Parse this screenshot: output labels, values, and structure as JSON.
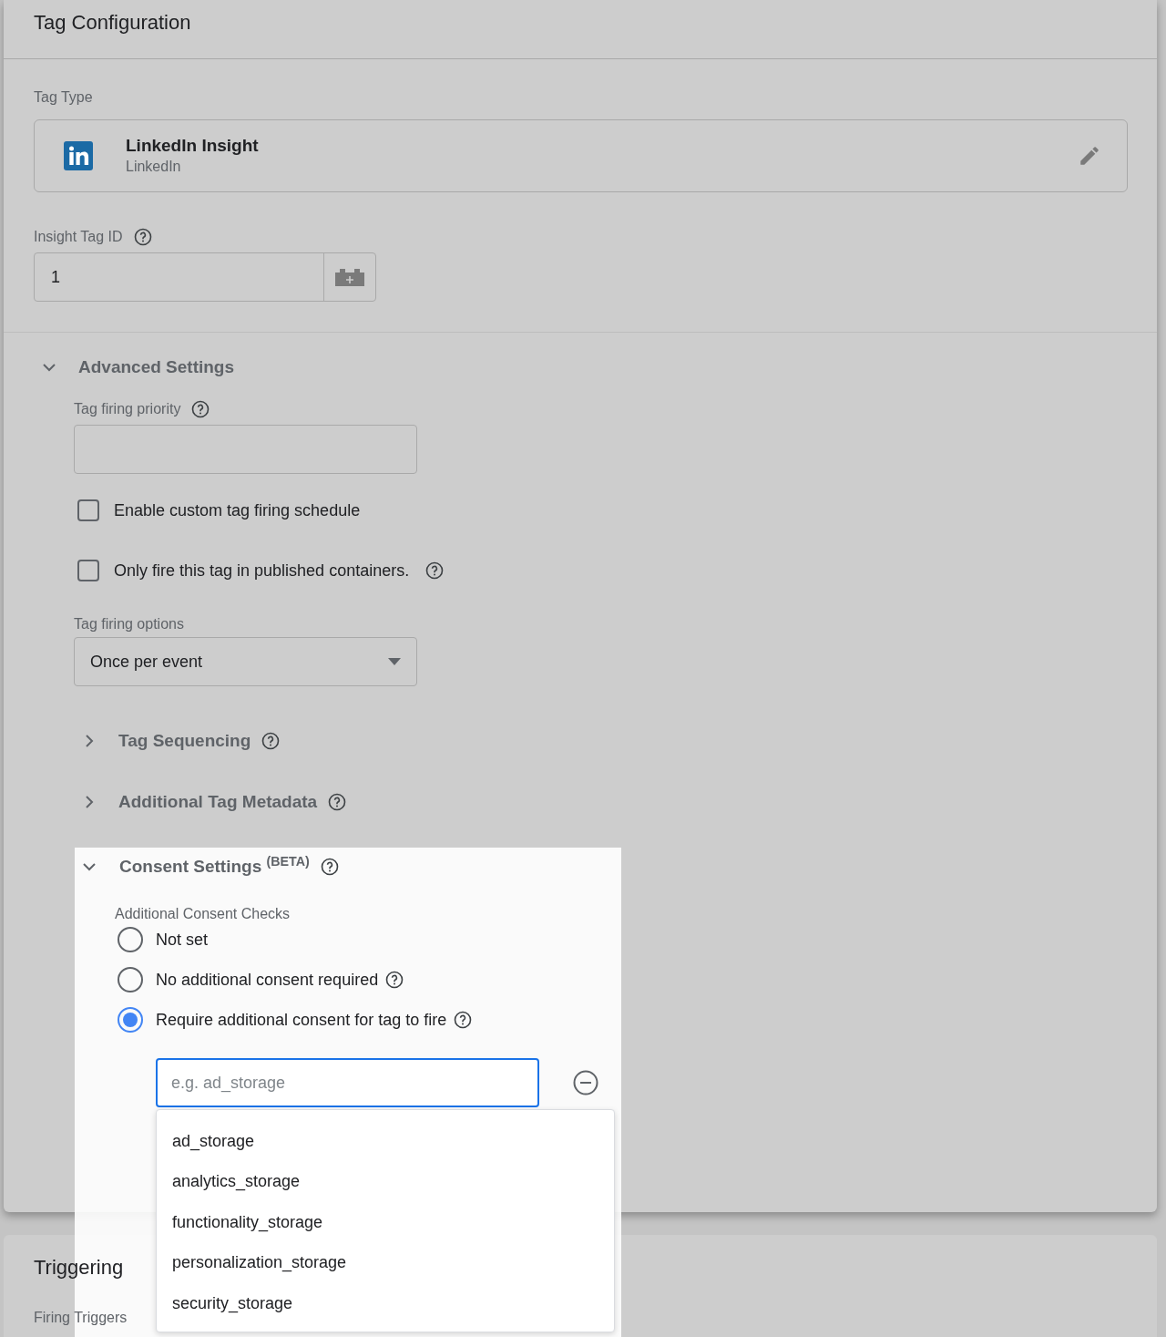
{
  "tag_configuration": {
    "title": "Tag Configuration",
    "tag_type": {
      "label": "Tag Type",
      "name": "LinkedIn Insight",
      "vendor": "LinkedIn"
    },
    "insight_tag_id": {
      "label": "Insight Tag ID",
      "value": "1"
    },
    "advanced_settings": {
      "title": "Advanced Settings",
      "expanded": true,
      "priority": {
        "label": "Tag firing priority"
      },
      "checkboxes": [
        {
          "label": "Enable custom tag firing schedule",
          "checked": false,
          "help": false
        },
        {
          "label": "Only fire this tag in published containers.",
          "checked": false,
          "help": true
        }
      ],
      "firing_options": {
        "label": "Tag firing options",
        "value": "Once per event"
      },
      "sections": [
        {
          "title": "Tag Sequencing",
          "expanded": false
        },
        {
          "title": "Additional Tag Metadata",
          "expanded": false
        }
      ]
    }
  },
  "consent_settings": {
    "title": "Consent Settings",
    "badge": "(BETA)",
    "expanded": true,
    "label": "Additional Consent Checks",
    "options": [
      {
        "label": "Not set",
        "selected": false,
        "help": false
      },
      {
        "label": "No additional consent required",
        "selected": false,
        "help": true
      },
      {
        "label": "Require additional consent for tag to fire",
        "selected": true,
        "help": true
      }
    ],
    "consent_field": {
      "placeholder": "e.g. ad_storage"
    },
    "suggestions": [
      "ad_storage",
      "analytics_storage",
      "functionality_storage",
      "personalization_storage",
      "security_storage"
    ]
  },
  "triggering": {
    "title": "Triggering",
    "label": "Firing Triggers"
  }
}
